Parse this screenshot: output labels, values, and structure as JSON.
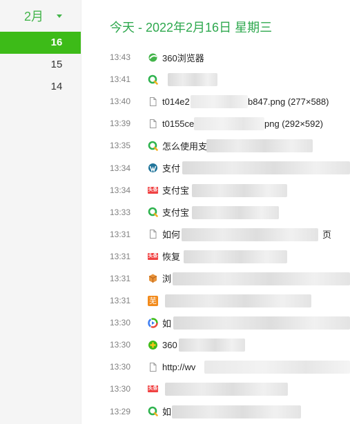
{
  "sidebar": {
    "month_label": "2月",
    "days": [
      "16",
      "15",
      "14"
    ]
  },
  "main": {
    "title": "今天 - 2022年2月16日 星期三",
    "entries": [
      {
        "time": "13:43",
        "icon": "360-browser-icon",
        "title": "360浏览器"
      },
      {
        "time": "13:41",
        "icon": "360-search-icon",
        "title": ""
      },
      {
        "time": "13:40",
        "icon": "file-icon",
        "title": "t014e2",
        "suffix": "b847.png (277×588)"
      },
      {
        "time": "13:39",
        "icon": "file-icon",
        "title": "t0155ce",
        "suffix": "png (292×592)"
      },
      {
        "time": "13:35",
        "icon": "360-search-icon",
        "title": "怎么使用支"
      },
      {
        "time": "13:34",
        "icon": "wordpress-icon",
        "title": "支付"
      },
      {
        "time": "13:34",
        "icon": "toutiao-icon",
        "title": "支付宝"
      },
      {
        "time": "13:33",
        "icon": "360-search-icon",
        "title": "支付宝"
      },
      {
        "time": "13:31",
        "icon": "file-icon",
        "title": "如何",
        "suffix": "页"
      },
      {
        "time": "13:31",
        "icon": "toutiao-icon",
        "title": "恢复"
      },
      {
        "time": "13:31",
        "icon": "box-icon",
        "title": "浏"
      },
      {
        "time": "13:31",
        "icon": "orange-badge-icon",
        "title": ""
      },
      {
        "time": "13:30",
        "icon": "colorful-circle-icon",
        "title": "如"
      },
      {
        "time": "13:30",
        "icon": "360-plus-icon",
        "title": "360"
      },
      {
        "time": "13:30",
        "icon": "file-icon",
        "title": "http://wv"
      },
      {
        "time": "13:30",
        "icon": "toutiao-icon",
        "title": ""
      },
      {
        "time": "13:29",
        "icon": "360-search-icon",
        "title": "如"
      }
    ],
    "toutiao_badge_text": "头条",
    "orange_badge_text": "芜"
  }
}
